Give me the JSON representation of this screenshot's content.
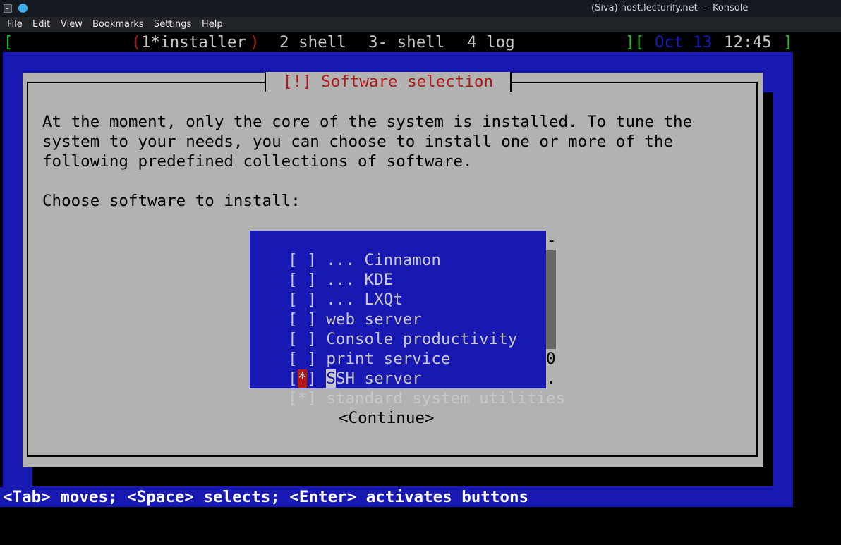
{
  "window": {
    "title": "(Siva) host.lecturify.net — Konsole"
  },
  "menu": [
    "File",
    "Edit",
    "View",
    "Bookmarks",
    "Settings",
    "Help"
  ],
  "screen_bar": {
    "open_bracket": "[",
    "active_open": "(",
    "active_tab": "1*installer",
    "active_close": ")",
    "tabs": [
      "2 shell",
      "3- shell",
      "4 log"
    ],
    "sep": "][",
    "date": "Oct 13",
    "time": "12:45",
    "close_bracket": "]"
  },
  "dialog": {
    "title": "[!] Software selection",
    "intro_lines": [
      "At the moment, only the core of the system is installed. To tune the",
      "system to your needs, you can choose to install one or more of the",
      "following predefined collections of software."
    ],
    "prompt": "Choose software to install:",
    "items": [
      {
        "checkbox": "[ ]",
        "label": "... Cinnamon"
      },
      {
        "checkbox": "[ ]",
        "label": "... KDE"
      },
      {
        "checkbox": "[ ]",
        "label": "... LXQt"
      },
      {
        "checkbox": "[ ]",
        "label": "web server"
      },
      {
        "checkbox": "[ ]",
        "label": "Console productivity"
      },
      {
        "checkbox": "[ ]",
        "label": "print service"
      },
      {
        "checkbox_open": "[",
        "checkbox_mark": "*",
        "checkbox_close": "]",
        "label_first": "S",
        "label_rest": "SH server"
      },
      {
        "checkbox": "[*]",
        "label": "standard system utilities"
      }
    ],
    "scroll_marks": {
      "top": "-",
      "mid": "0",
      "bottom": "."
    },
    "continue_button": "<Continue>"
  },
  "status_line": "<Tab> moves; <Space> selects; <Enter> activates buttons",
  "colors": {
    "screen_blue": "#1818b2",
    "dialog_gray": "#b2b2b2",
    "title_red": "#b21818",
    "bar_green": "#14c81e"
  }
}
